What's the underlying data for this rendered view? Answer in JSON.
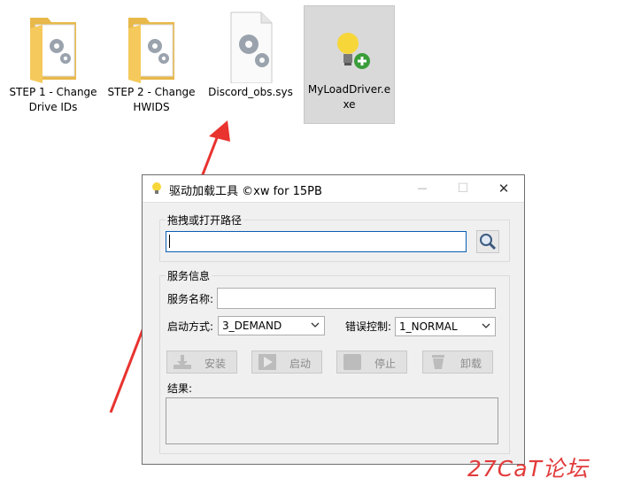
{
  "desktop": {
    "icons": [
      {
        "label": "STEP 1 - Change Drive IDs"
      },
      {
        "label": "STEP 2 - Change HWIDS"
      },
      {
        "label": "Discord_obs.sys"
      },
      {
        "label": "MyLoadDriver.exe"
      }
    ]
  },
  "window": {
    "title": "驱动加载工具 ©xw for 15PB",
    "minimize": "—",
    "maximize": "☐",
    "close": "✕",
    "path_group_label": "拖拽或打开路径",
    "path_value": "",
    "service_group_label": "服务信息",
    "service_name_label": "服务名称:",
    "service_name_value": "",
    "start_type_label": "启动方式:",
    "start_type_value": "3_DEMAND",
    "error_control_label": "错误控制:",
    "error_control_value": "1_NORMAL",
    "buttons": {
      "install": "安装",
      "start": "启动",
      "stop": "停止",
      "uninstall": "卸载"
    },
    "result_label": "结果:",
    "result_value": ""
  },
  "watermark": "27CaT论坛",
  "colors": {
    "arrow": "#e8332f",
    "folder": "#f5c95b",
    "selection": "#d9d9d9"
  }
}
